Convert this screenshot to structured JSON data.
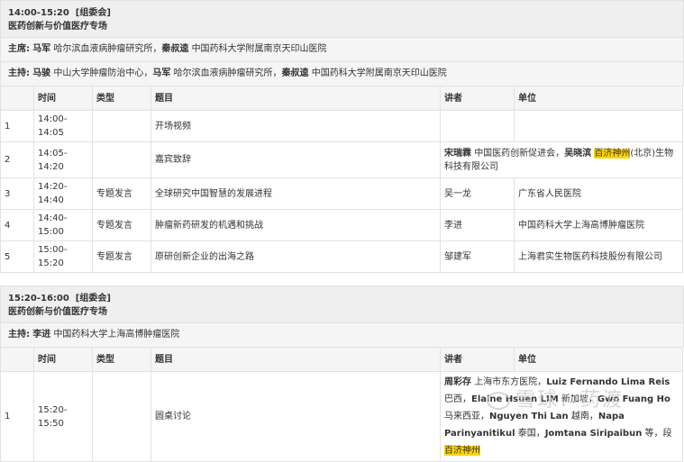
{
  "session1": {
    "time": "14:00-15:20",
    "organizer": "[组委会]",
    "title": "医药创新与价值医疗专场",
    "chair_label": "主席:",
    "chair_1_name": "马军",
    "chair_1_org": "哈尔滨血液病肿瘤研究所，",
    "chair_2_name": "秦叔逵",
    "chair_2_org": "中国药科大学附属南京天印山医院",
    "host_label": "主持:",
    "host_1_name": "马骏",
    "host_1_org": "中山大学肿瘤防治中心，",
    "host_2_name": "马军",
    "host_2_org": "哈尔滨血液病肿瘤研究所，",
    "host_3_name": "秦叔逵",
    "host_3_org": "中国药科大学附属南京天印山医院",
    "headers": {
      "no": "",
      "time": "时间",
      "type": "类型",
      "topic": "题目",
      "speaker": "讲者",
      "unit": "单位"
    },
    "rows": [
      {
        "no": "1",
        "time": "14:00-14:05",
        "type": "",
        "topic": "开场视频",
        "speaker": "",
        "unit": ""
      },
      {
        "no": "2",
        "time": "14:05-14:20",
        "type": "",
        "topic": "嘉宾致辞",
        "sp_1_name": "宋瑞霖",
        "sp_1_org": "中国医药创新促进会，",
        "sp_2_name": "吴晓滨",
        "sp_2_hl": "百济神州",
        "sp_2_org": "(北京)生物科技有限公司"
      },
      {
        "no": "3",
        "time": "14:20-14:40",
        "type": "专题发言",
        "topic": "全球研究中国智慧的发展进程",
        "speaker": "吴一龙",
        "unit": "广东省人民医院"
      },
      {
        "no": "4",
        "time": "14:40-15:00",
        "type": "专题发言",
        "topic": "肿瘤新药研发的机遇和挑战",
        "speaker": "李进",
        "unit": "中国药科大学上海高博肿瘤医院"
      },
      {
        "no": "5",
        "time": "15:00-15:20",
        "type": "专题发言",
        "topic": "原研创新企业的出海之路",
        "speaker": "邹建军",
        "unit": "上海君实生物医药科技股份有限公司"
      }
    ]
  },
  "session2": {
    "time": "15:20-16:00",
    "organizer": "[组委会]",
    "title": "医药创新与价值医疗专场",
    "host_label": "主持:",
    "host_1_name": "李进",
    "host_1_org": "中国药科大学上海高博肿瘤医院",
    "headers": {
      "no": "",
      "time": "时间",
      "type": "类型",
      "topic": "题目",
      "speaker": "讲者",
      "unit": "单位"
    },
    "row1": {
      "no": "1",
      "time": "15:20-15:50",
      "type": "",
      "topic": "圆桌讨论",
      "p1_name": "周彩存",
      "p1_org": "上海市东方医院，",
      "p2_name": "Luiz Fernando Lima Reis",
      "p2_org": "巴西，",
      "p3_name": "Elaine Hsuen LIM",
      "p3_org": "新加坡，",
      "p4_name": "Gwo Fuang Ho",
      "p4_org": "马来西亚，",
      "p5_name": "Nguyen Thi Lan",
      "p5_org": "越南，",
      "p6_name": "Napa Parinyanitikul",
      "p6_org": "泰国，",
      "p7_name": "Jomtana Siripaibun",
      "p7_org": "等，",
      "p7_tail": "段",
      "p7_hl": "百济神州"
    }
  },
  "watermark": "雪球：药渡"
}
